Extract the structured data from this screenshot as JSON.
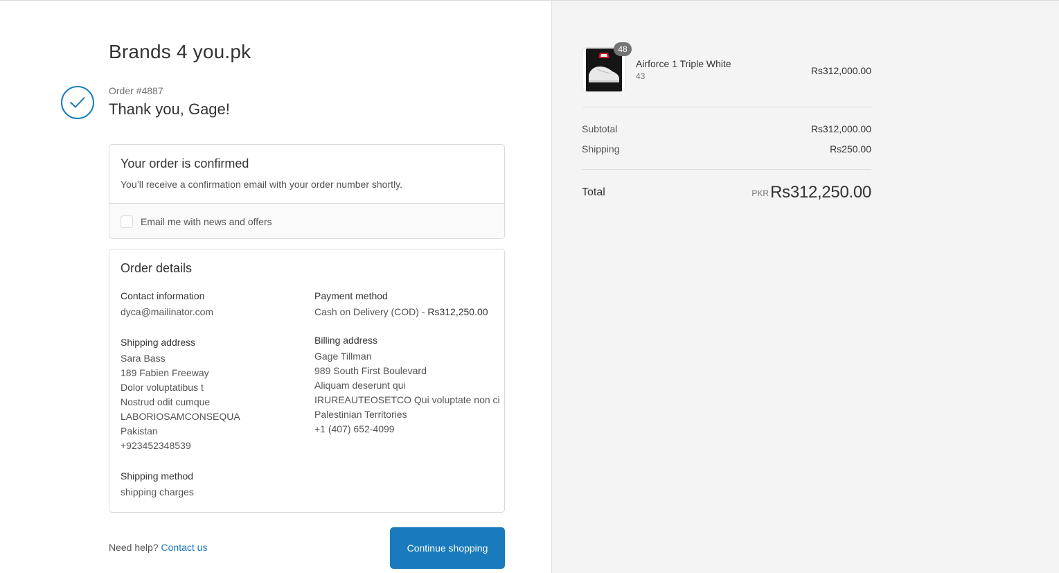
{
  "store": {
    "name": "Brands 4 you.pk"
  },
  "order": {
    "number": "Order #4887",
    "thank_you": "Thank you, Gage!"
  },
  "confirmation": {
    "title": "Your order is confirmed",
    "message": "You’ll receive a confirmation email with your order number shortly.",
    "newsletter_label": "Email me with news and offers",
    "newsletter_checked": false
  },
  "details": {
    "title": "Order details",
    "contact": {
      "title": "Contact information",
      "email": "dyca@mailinator.com"
    },
    "payment": {
      "title": "Payment method",
      "method": "Cash on Delivery (COD) - ",
      "amount": "Rs312,250.00"
    },
    "shipping_address": {
      "title": "Shipping address",
      "lines": [
        "Sara Bass",
        "189 Fabien Freeway",
        "Dolor voluptatibus t",
        "Nostrud odit cumque",
        "LABORIOSAMCONSEQUA",
        "Pakistan",
        "+923452348539"
      ]
    },
    "billing_address": {
      "title": "Billing address",
      "lines": [
        "Gage Tillman",
        "989 South First Boulevard",
        "Aliquam deserunt qui",
        "IRUREAUTEOSETCO Qui voluptate non ci",
        "Palestinian Territories",
        "+1 (407) 652-4099"
      ]
    },
    "shipping_method": {
      "title": "Shipping method",
      "value": "shipping charges"
    }
  },
  "footer": {
    "help_text": "Need help?",
    "contact_link": "Contact us",
    "continue_button": "Continue shopping"
  },
  "summary": {
    "product": {
      "name": "Airforce 1 Triple White",
      "variant": "43",
      "price": "Rs312,000.00",
      "quantity": "48"
    },
    "subtotal_label": "Subtotal",
    "subtotal_value": "Rs312,000.00",
    "shipping_label": "Shipping",
    "shipping_value": "Rs250.00",
    "total_label": "Total",
    "currency": "PKR",
    "total_value": "Rs312,250.00"
  },
  "colors": {
    "accent": "#197bbd",
    "sidebar_bg": "#f4f4f4"
  }
}
